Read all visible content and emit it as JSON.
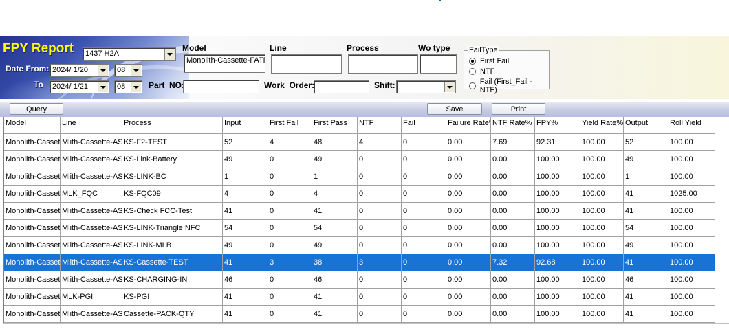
{
  "header": {
    "title": "FPY Report",
    "product": "1437 H2A",
    "date_from_label": "Date From:",
    "date_from": "2024/ 1/20",
    "date_from_hour": "08",
    "to_label": "To",
    "date_to": "2024/ 1/21",
    "date_to_hour": "08",
    "model_label": "Model",
    "model_value": "Monolith-Cassette-FATF",
    "line_label": "Line",
    "line_value": "",
    "process_label": "Process",
    "process_value": "",
    "wo_type_label": "Wo type",
    "wo_type_value": "",
    "part_no_label": "Part_NO:",
    "part_no_value": "",
    "work_order_label": "Work_Order:",
    "work_order_value": "",
    "shift_label": "Shift:",
    "shift_value": ""
  },
  "failtype": {
    "legend": "FailType",
    "options": [
      {
        "label": "First Fail",
        "selected": true
      },
      {
        "label": "NTF",
        "selected": false
      },
      {
        "label": "Fail (First_Fail - NTF)",
        "selected": false
      }
    ]
  },
  "toolbar": {
    "query_label": "Query",
    "save_label": "Save",
    "print_label": "Print"
  },
  "table": {
    "columns": [
      "Model",
      "Line",
      "Process",
      "Input",
      "First Fail",
      "First Pass",
      "NTF",
      "Fail",
      "Failure Rate%",
      "NTF Rate%",
      "FPY%",
      "Yield Rate%",
      "Output",
      "Roll Yield"
    ],
    "selected_row": 7,
    "rows": [
      [
        "Monolith-Cassette",
        "Mlith-Cassette-ASSY",
        "KS-F2-TEST",
        "52",
        "4",
        "48",
        "4",
        "0",
        "0.00",
        "7.69",
        "92.31",
        "100.00",
        "52",
        "100.00"
      ],
      [
        "Monolith-Cassette",
        "Mlith-Cassette-ASSY",
        "KS-Link-Battery",
        "49",
        "0",
        "49",
        "0",
        "0",
        "0.00",
        "0.00",
        "100.00",
        "100.00",
        "49",
        "100.00"
      ],
      [
        "Monolith-Cassette",
        "Mlith-Cassette-ASSY",
        "KS-LINK-BC",
        "1",
        "0",
        "1",
        "0",
        "0",
        "0.00",
        "0.00",
        "100.00",
        "100.00",
        "1",
        "100.00"
      ],
      [
        "Monolith-Cassette",
        "MLK_FQC",
        "KS-FQC09",
        "4",
        "0",
        "4",
        "0",
        "0",
        "0.00",
        "0.00",
        "100.00",
        "100.00",
        "41",
        "1025.00"
      ],
      [
        "Monolith-Cassette",
        "Mlith-Cassette-ASSY",
        "KS-Check FCC-Test",
        "41",
        "0",
        "41",
        "0",
        "0",
        "0.00",
        "0.00",
        "100.00",
        "100.00",
        "41",
        "100.00"
      ],
      [
        "Monolith-Cassette",
        "Mlith-Cassette-ASSY",
        "KS-LINK-Triangle NFC",
        "54",
        "0",
        "54",
        "0",
        "0",
        "0.00",
        "0.00",
        "100.00",
        "100.00",
        "54",
        "100.00"
      ],
      [
        "Monolith-Cassette",
        "Mlith-Cassette-ASSY",
        "KS-LINK-MLB",
        "49",
        "0",
        "49",
        "0",
        "0",
        "0.00",
        "0.00",
        "100.00",
        "100.00",
        "49",
        "100.00"
      ],
      [
        "Monolith-Cassette",
        "Mlith-Cassette-ASSY",
        "KS-Cassette-TEST",
        "41",
        "3",
        "38",
        "3",
        "0",
        "0.00",
        "7.32",
        "92.68",
        "100.00",
        "41",
        "100.00"
      ],
      [
        "Monolith-Cassette",
        "Mlith-Cassette-ASSY",
        "KS-CHARGING-IN",
        "46",
        "0",
        "46",
        "0",
        "0",
        "0.00",
        "0.00",
        "100.00",
        "100.00",
        "46",
        "100.00"
      ],
      [
        "Monolith-Cassette",
        "MLK-PGI",
        "KS-PGI",
        "41",
        "0",
        "41",
        "0",
        "0",
        "0.00",
        "0.00",
        "100.00",
        "100.00",
        "41",
        "100.00"
      ],
      [
        "Monolith-Cassette",
        "Mlith-Cassette-ASSY",
        "Cassette-PACK-QTY",
        "41",
        "0",
        "41",
        "0",
        "0",
        "0.00",
        "0.00",
        "100.00",
        "100.00",
        "41",
        "100.00"
      ]
    ]
  }
}
